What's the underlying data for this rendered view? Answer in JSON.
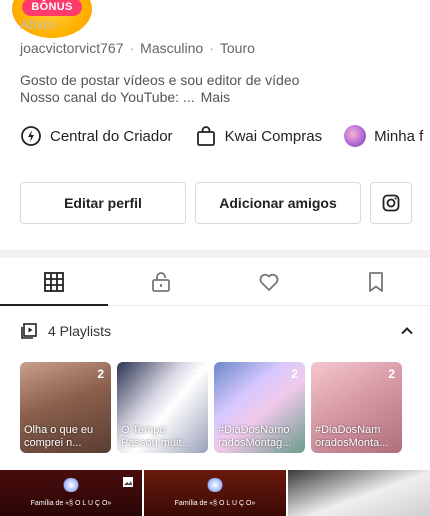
{
  "bonus": {
    "label": "BÔNUS"
  },
  "profile": {
    "follow_text": "Ativo",
    "username": "joacvictorvict767",
    "gender": "Masculino",
    "sign": "Touro",
    "bio_line1": "Gosto de postar vídeos e sou editor de vídeo",
    "bio_line2": "Nosso canal do YouTube: ...",
    "bio_more": "Mais"
  },
  "links": {
    "creator_center": "Central do Criador",
    "kwai_shopping": "Kwai Compras",
    "my_profile": "Minha f"
  },
  "buttons": {
    "edit_profile": "Editar perfil",
    "add_friends": "Adicionar amigos"
  },
  "tabs": [
    {
      "name": "grid",
      "icon": "grid-icon",
      "active": true
    },
    {
      "name": "private",
      "icon": "lock-icon",
      "active": false
    },
    {
      "name": "likes",
      "icon": "heart-icon",
      "active": false
    },
    {
      "name": "saved",
      "icon": "bookmark-icon",
      "active": false
    }
  ],
  "playlists": {
    "header": "4 Playlists",
    "items": [
      {
        "count": "2",
        "caption": "Olha o que eu comprei n..."
      },
      {
        "count": "3",
        "caption": "O Tempo Passou muit..."
      },
      {
        "count": "2",
        "caption": "#DiaDosNamo radosMontag..."
      },
      {
        "count": "2",
        "caption": "#DiaDosNam oradosMonta..."
      }
    ]
  },
  "videos": [
    {
      "caption": "Família de «§ O L U Ç O»"
    },
    {
      "caption": "Família de «§ O L U Ç O»"
    }
  ],
  "colors": {
    "bonus_pink": "#ff3b6b",
    "bonus_gold": "#ffb300",
    "text_dark": "#222222",
    "border": "#d9d9d9"
  }
}
